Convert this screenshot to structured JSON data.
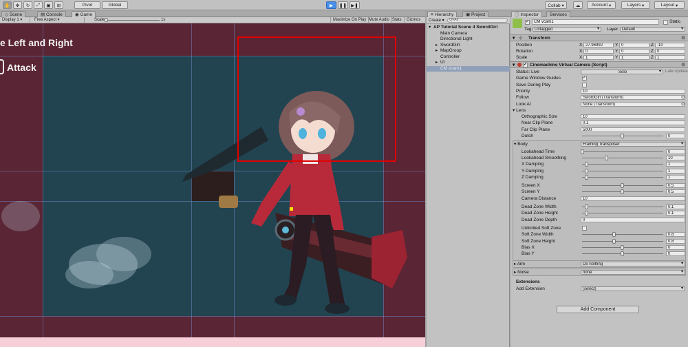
{
  "toolbar": {
    "pivot": "Pivot",
    "global": "Global",
    "collab": "Collab ▾",
    "account": "Account",
    "layers": "Layers",
    "layout": "Layout"
  },
  "scene_tabs": {
    "scene": "Scene",
    "console": "Console",
    "game": "Game"
  },
  "game_bar": {
    "display": "Display 1",
    "aspect": "Free Aspect",
    "scale_label": "Scale",
    "scale_value": "1x",
    "maximize": "Maximize On Play",
    "mute": "Mute Audio",
    "stats": "Stats",
    "gizmos": "Gizmos"
  },
  "game_view": {
    "title_text": "e Left and Right",
    "attack_text": "Attack"
  },
  "hierarchy": {
    "tab_hierarchy": "Hierarchy",
    "tab_project": "Project",
    "create": "Create ▾",
    "search": "Q▾All",
    "items": [
      {
        "label": "AP Tutorial Scene 4 SwordGirl",
        "indent": 0,
        "arrow": "▾",
        "selected": false,
        "bold": true
      },
      {
        "label": "Main Camera",
        "indent": 1,
        "arrow": "",
        "selected": false,
        "bold": false
      },
      {
        "label": "Directional Light",
        "indent": 1,
        "arrow": "",
        "selected": false,
        "bold": false
      },
      {
        "label": "SwordGirl",
        "indent": 1,
        "arrow": "▸",
        "selected": false,
        "bold": false
      },
      {
        "label": "MapGroup",
        "indent": 1,
        "arrow": "▸",
        "selected": false,
        "bold": false
      },
      {
        "label": "Controller",
        "indent": 1,
        "arrow": "",
        "selected": false,
        "bold": false
      },
      {
        "label": "UI",
        "indent": 1,
        "arrow": "▸",
        "selected": false,
        "bold": false
      },
      {
        "label": "CM vcam1",
        "indent": 1,
        "arrow": "",
        "selected": true,
        "bold": false
      }
    ]
  },
  "inspector": {
    "tab_inspector": "Inspector",
    "tab_services": "Services",
    "object_name": "CM vcam1",
    "static_label": "Static",
    "tag_label": "Tag",
    "tag_value": "Untagged",
    "layer_label": "Layer",
    "layer_value": "Default",
    "transform": {
      "header": "Transform",
      "position_label": "Position",
      "rotation_label": "Rotation",
      "scale_label": "Scale",
      "position": [
        "27.96992",
        "0",
        "-10"
      ],
      "rotation": [
        "0",
        "0",
        "0"
      ],
      "scale": [
        "1",
        "1",
        "1"
      ]
    },
    "vcam": {
      "header": "Cinemachine Virtual Camera (Script)",
      "status_label": "Status: Live",
      "solo_label": "Solo",
      "late_update": "Late Update",
      "game_window_guides": "Game Window Guides",
      "save_during_play": "Save During Play",
      "priority_label": "Priority",
      "priority_value": "10",
      "follow_label": "Follow",
      "follow_value": "SwordGirl (Transform)",
      "lookat_label": "Look At",
      "lookat_value": "None (Transform)",
      "lens_label": "Lens",
      "ortho_label": "Orthographic Size",
      "ortho_value": "10",
      "near_label": "Near Clip Plane",
      "near_value": "0.1",
      "far_label": "Far Clip Plane",
      "far_value": "5000",
      "dutch_label": "Dutch",
      "dutch_value": "0"
    },
    "body": {
      "label": "Body",
      "value": "Framing Transposer",
      "lookahead_time_label": "Lookahead Time",
      "lookahead_time": "0",
      "lookahead_smoothing_label": "Lookahead Smoothing",
      "lookahead_smoothing": "10",
      "x_damping_label": "X Damping",
      "x_damping": "1",
      "y_damping_label": "Y Damping",
      "y_damping": "1",
      "z_damping_label": "Z Damping",
      "z_damping": "1",
      "screen_x_label": "Screen X",
      "screen_x": "0.5",
      "screen_y_label": "Screen Y",
      "screen_y": "0.5",
      "camera_distance_label": "Camera Distance",
      "camera_distance": "10",
      "dead_width_label": "Dead Zone Width",
      "dead_width": "0.1",
      "dead_height_label": "Dead Zone Height",
      "dead_height": "0.1",
      "dead_depth_label": "Dead Zone Depth",
      "dead_depth": "0",
      "unlimited_soft_label": "Unlimited Soft Zone",
      "soft_width_label": "Soft Zone Width",
      "soft_width": "0.8",
      "soft_height_label": "Soft Zone Height",
      "soft_height": "0.8",
      "bias_x_label": "Bias X",
      "bias_x": "0",
      "bias_y_label": "Bias Y",
      "bias_y": "0"
    },
    "aim_label": "Aim",
    "aim_value": "Do nothing",
    "noise_label": "Noise",
    "noise_value": "none",
    "extensions_label": "Extensions",
    "add_extension_label": "Add Extension",
    "add_extension_value": "(select)",
    "add_component": "Add Component"
  },
  "colors": {
    "game_bg": "#5a2534",
    "dead_zone": "#214450",
    "highlight_box": "#e00000",
    "play_button": "#4a8fe7"
  }
}
